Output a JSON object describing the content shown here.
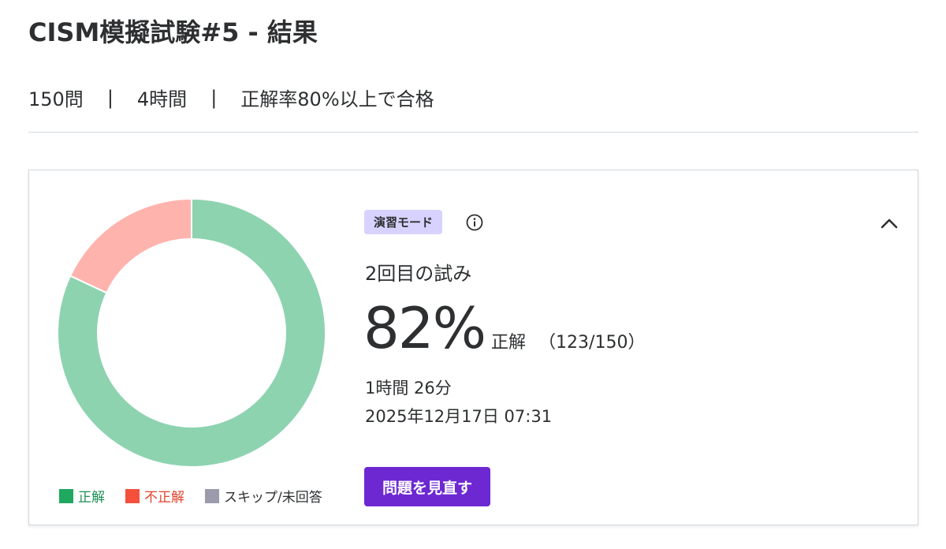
{
  "header": {
    "title": "CISM模擬試験#5 - 結果"
  },
  "meta": {
    "questions": "150問",
    "separator": "|",
    "duration": "4時間",
    "pass_criteria": "正解率80%以上で合格"
  },
  "result": {
    "mode_badge": "演習モード",
    "attempt": "2回目の試み",
    "score": "82%",
    "score_label": "正解",
    "score_count": "（123/150）",
    "time_taken": "1時間 26分",
    "datetime": "2025年12月17日 07:31",
    "review_button": "問題を見直す"
  },
  "chart_data": {
    "type": "pie",
    "categories": [
      "正解",
      "不正解",
      "スキップ/未回答"
    ],
    "values": [
      123,
      27,
      0
    ],
    "colors": [
      "#8dd3b0",
      "#ffb3ad",
      "#9b9bad"
    ],
    "legend": [
      {
        "label": "正解",
        "swatch": "#1fa860",
        "text_color": "#1e8f54"
      },
      {
        "label": "不正解",
        "swatch": "#f4503c",
        "text_color": "#e0442e"
      },
      {
        "label": "スキップ/未回答",
        "swatch": "#9b9bad",
        "text_color": "#2d2f31"
      }
    ]
  },
  "icons": {
    "info": "info-icon",
    "collapse": "chevron-up-icon"
  }
}
